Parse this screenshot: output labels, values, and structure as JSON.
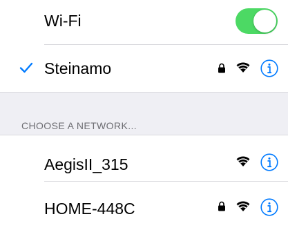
{
  "wifi": {
    "label": "Wi-Fi",
    "enabled": true
  },
  "current_network": {
    "name": "Steinamo",
    "connected": true,
    "secured": true
  },
  "section": {
    "title": "CHOOSE A NETWORK..."
  },
  "networks": [
    {
      "name": "AegisII_315",
      "secured": false
    },
    {
      "name": "HOME-448C",
      "secured": true
    }
  ],
  "colors": {
    "toggle_on": "#4cd964",
    "accent": "#007aff",
    "section_bg": "#efeff4",
    "section_text": "#6d6d72",
    "separator": "#d9d9de"
  },
  "icons": {
    "check": "checkmark-icon",
    "lock": "lock-icon",
    "wifi": "wifi-signal-icon",
    "info": "info-icon"
  }
}
